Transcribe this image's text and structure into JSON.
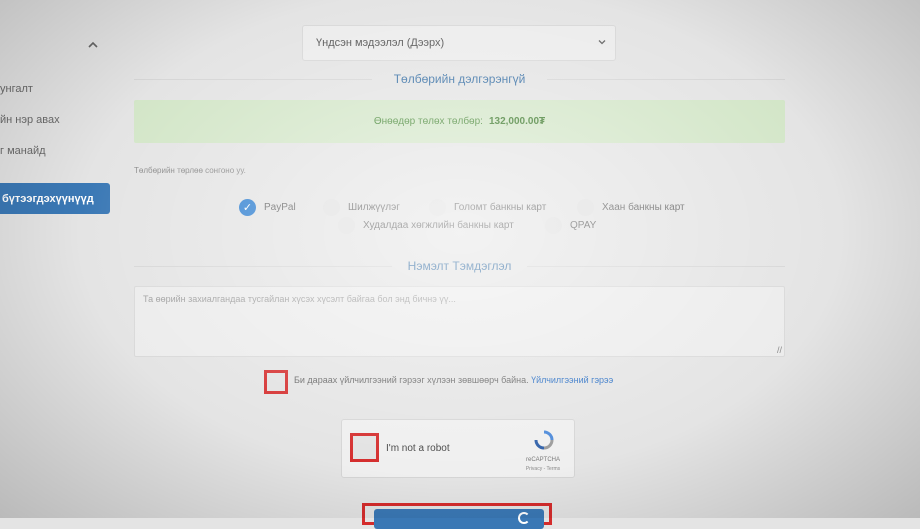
{
  "sidebar": {
    "items": [
      {
        "label": "унгалт"
      },
      {
        "label": "йн нэр авах"
      },
      {
        "label": "г манайд"
      }
    ],
    "active_label": "бүтээгдэхүүнүүд"
  },
  "info_select": {
    "value": "Үндсэн мэдээлэл (Дээрх)"
  },
  "payment_details": {
    "title": "Төлбөрийн дэлгэрэнгүй",
    "due_label": "Өнөөдөр төлөх төлбөр:",
    "due_amount": "132,000.00₮",
    "method_hint": "Төлбөрийн төрлөө сонгоно уу.",
    "methods": [
      {
        "label": "PayPal",
        "checked": true
      },
      {
        "label": "Шилжүүлэг",
        "checked": false
      },
      {
        "label": "Голомт банкны карт",
        "checked": false
      },
      {
        "label": "Хаан банкны карт",
        "checked": false
      },
      {
        "label": "Худалдаа хөгжлийн банкны карт",
        "checked": false
      },
      {
        "label": "QPAY",
        "checked": false
      }
    ]
  },
  "notes": {
    "title": "Нэмэлт Тэмдэглэл",
    "placeholder": "Та өөрийн захиалгандаа тусгайлан хүсэх хүсэлт байгаа бол энд бичнэ үү..."
  },
  "terms": {
    "text": "Би дараах үйлчилгээний гэрээг хүлээн зөвшөөрч байна.",
    "link": "Үйлчилгээний гэрээ"
  },
  "recaptcha": {
    "label": "I'm not a robot",
    "brand": "reCAPTCHA",
    "links": "Privacy - Terms"
  },
  "colors": {
    "accent": "#3a78b5",
    "highlight": "#d42c2c",
    "success_bg": "#d3e6c8",
    "radio_checked": "#2f7fd0"
  }
}
